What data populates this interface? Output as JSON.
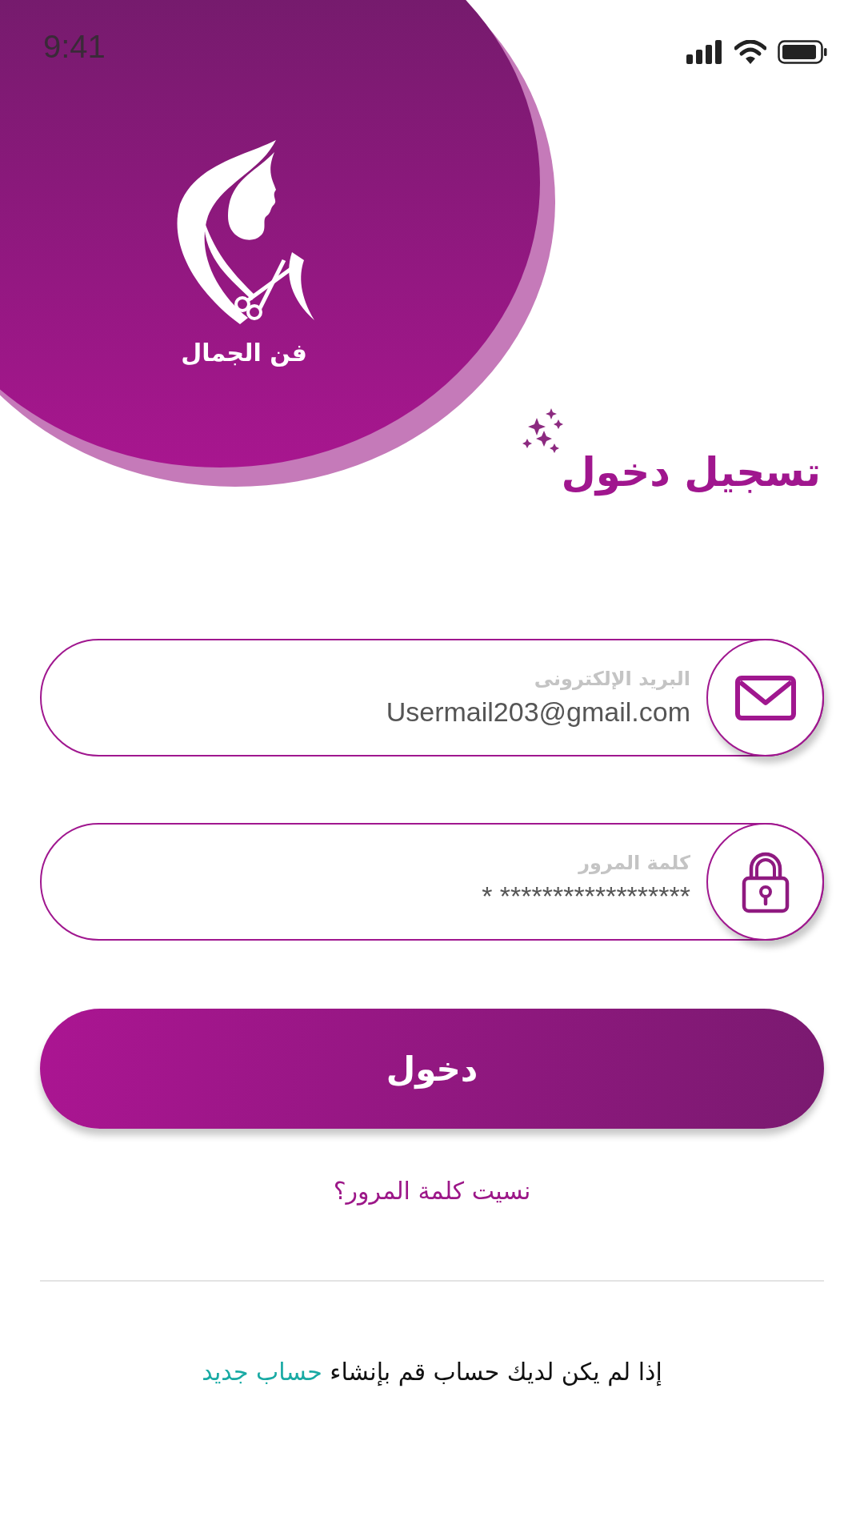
{
  "status_bar": {
    "time": "9:41"
  },
  "brand": {
    "name": "فن الجمال"
  },
  "title": "تسجيل دخول",
  "fields": [
    {
      "kind": "email",
      "label": "البريد الإلكترونى",
      "value": "Usermail203@gmail.com"
    },
    {
      "kind": "password",
      "label": "كلمة المرور",
      "value": "* ******************"
    }
  ],
  "login_button": "دخول",
  "forgot_link": "نسيت كلمة المرور؟",
  "signup": {
    "text": "إذا لم يكن لديك حساب قم بإنشاء",
    "link": "حساب جديد"
  }
}
